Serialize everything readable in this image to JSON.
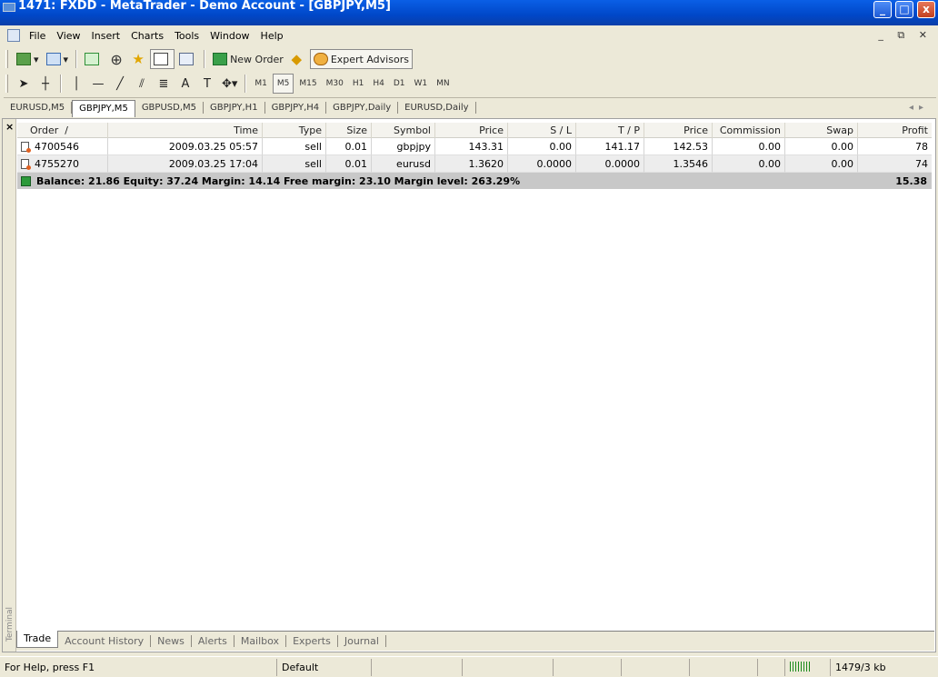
{
  "window": {
    "title": "1471: FXDD - MetaTrader - Demo Account - [GBPJPY,M5]",
    "controls": [
      "_",
      "□",
      "x"
    ]
  },
  "menubar": {
    "items": [
      "File",
      "View",
      "Insert",
      "Charts",
      "Tools",
      "Window",
      "Help"
    ],
    "mdi_controls": "_ ⧉ ✕"
  },
  "toolbar": {
    "new_order_label": "New Order",
    "expert_advisors_label": "Expert Advisors",
    "timeframes": [
      "M1",
      "M5",
      "M15",
      "M30",
      "H1",
      "H4",
      "D1",
      "W1",
      "MN"
    ],
    "active_timeframe": "M5"
  },
  "chart_tabs": {
    "items": [
      "EURUSD,M5",
      "GBPJPY,M5",
      "GBPUSD,M5",
      "GBPJPY,H1",
      "GBPJPY,H4",
      "GBPJPY,Daily",
      "EURUSD,Daily"
    ],
    "active": "GBPJPY,M5"
  },
  "terminal": {
    "side_label": "Terminal",
    "columns": [
      "Order",
      "/",
      "Time",
      "Type",
      "Size",
      "Symbol",
      "Price",
      "S / L",
      "T / P",
      "Price",
      "Commission",
      "Swap",
      "Profit"
    ],
    "orders": [
      {
        "order": "4700546",
        "time": "2009.03.25 05:57",
        "type": "sell",
        "size": "0.01",
        "symbol": "gbpjpy",
        "price": "143.31",
        "sl": "0.00",
        "tp": "141.17",
        "price2": "142.53",
        "commission": "0.00",
        "swap": "0.00",
        "profit": "78"
      },
      {
        "order": "4755270",
        "time": "2009.03.25 17:04",
        "type": "sell",
        "size": "0.01",
        "symbol": "eurusd",
        "price": "1.3620",
        "sl": "0.0000",
        "tp": "0.0000",
        "price2": "1.3546",
        "commission": "0.00",
        "swap": "0.00",
        "profit": "74"
      }
    ],
    "balance_line": "Balance: 21.86  Equity: 37.24  Margin: 14.14  Free margin: 23.10  Margin level: 263.29%",
    "total_profit": "15.38",
    "tabs": [
      "Trade",
      "Account History",
      "News",
      "Alerts",
      "Mailbox",
      "Experts",
      "Journal"
    ],
    "active_tab": "Trade"
  },
  "statusbar": {
    "help": "For Help, press F1",
    "profile": "Default",
    "traffic": "1479/3 kb"
  }
}
